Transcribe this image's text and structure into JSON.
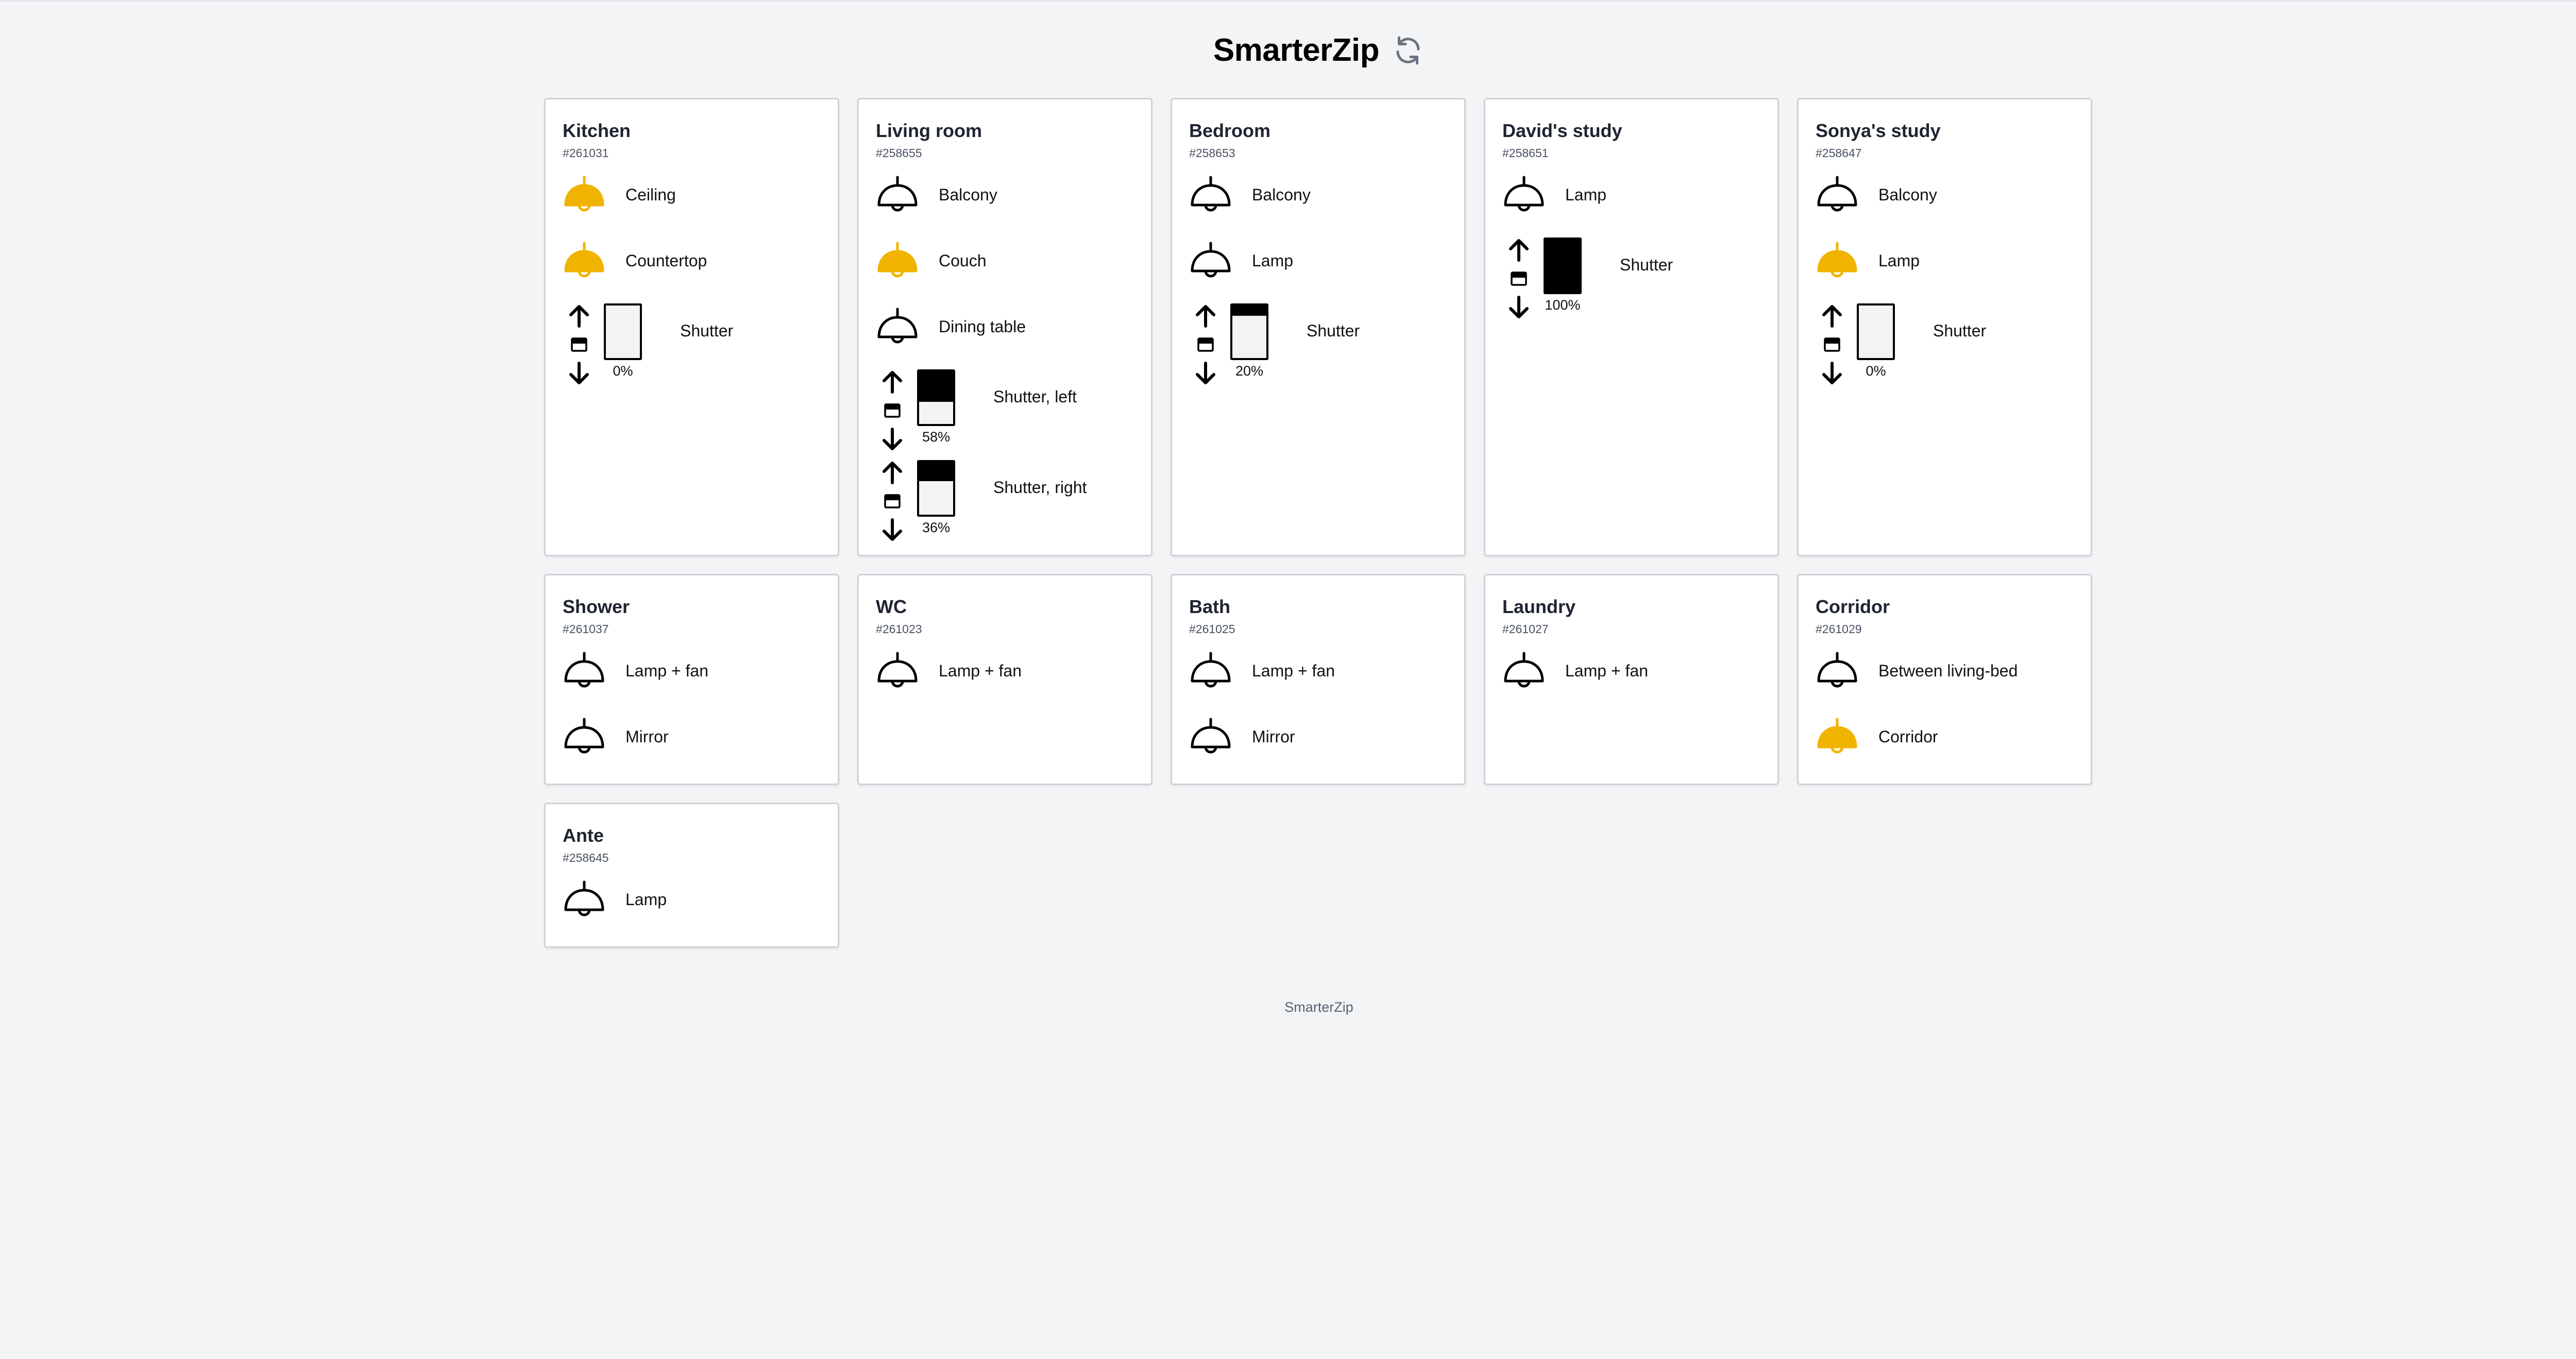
{
  "app": {
    "title": "SmarterZip",
    "footer": "SmarterZip",
    "refresh_icon": "refresh-icon"
  },
  "colors": {
    "lamp_on": "#f0b400",
    "lamp_off": "#ffffff",
    "background": "#f3f4f6"
  },
  "rooms": [
    {
      "name": "Kitchen",
      "id": "#261031",
      "devices": [
        {
          "type": "lamp",
          "label": "Ceiling",
          "on": true
        },
        {
          "type": "lamp",
          "label": "Countertop",
          "on": true
        },
        {
          "type": "shutter",
          "label": "Shutter",
          "percent": 0,
          "percent_text": "0%"
        }
      ]
    },
    {
      "name": "Living room",
      "id": "#258655",
      "devices": [
        {
          "type": "lamp",
          "label": "Balcony",
          "on": false
        },
        {
          "type": "lamp",
          "label": "Couch",
          "on": true
        },
        {
          "type": "lamp",
          "label": "Dining table",
          "on": false
        },
        {
          "type": "shutter",
          "label": "Shutter, left",
          "percent": 58,
          "percent_text": "58%"
        },
        {
          "type": "shutter",
          "label": "Shutter, right",
          "percent": 36,
          "percent_text": "36%"
        }
      ]
    },
    {
      "name": "Bedroom",
      "id": "#258653",
      "devices": [
        {
          "type": "lamp",
          "label": "Balcony",
          "on": false
        },
        {
          "type": "lamp",
          "label": "Lamp",
          "on": false
        },
        {
          "type": "shutter",
          "label": "Shutter",
          "percent": 20,
          "percent_text": "20%"
        }
      ]
    },
    {
      "name": "David's study",
      "id": "#258651",
      "devices": [
        {
          "type": "lamp",
          "label": "Lamp",
          "on": false
        },
        {
          "type": "shutter",
          "label": "Shutter",
          "percent": 100,
          "percent_text": "100%"
        }
      ]
    },
    {
      "name": "Sonya's study",
      "id": "#258647",
      "devices": [
        {
          "type": "lamp",
          "label": "Balcony",
          "on": false
        },
        {
          "type": "lamp",
          "label": "Lamp",
          "on": true
        },
        {
          "type": "shutter",
          "label": "Shutter",
          "percent": 0,
          "percent_text": "0%"
        }
      ]
    },
    {
      "name": "Shower",
      "id": "#261037",
      "devices": [
        {
          "type": "lamp",
          "label": "Lamp + fan",
          "on": false
        },
        {
          "type": "lamp",
          "label": "Mirror",
          "on": false
        }
      ]
    },
    {
      "name": "WC",
      "id": "#261023",
      "devices": [
        {
          "type": "lamp",
          "label": "Lamp + fan",
          "on": false
        }
      ]
    },
    {
      "name": "Bath",
      "id": "#261025",
      "devices": [
        {
          "type": "lamp",
          "label": "Lamp + fan",
          "on": false
        },
        {
          "type": "lamp",
          "label": "Mirror",
          "on": false
        }
      ]
    },
    {
      "name": "Laundry",
      "id": "#261027",
      "devices": [
        {
          "type": "lamp",
          "label": "Lamp + fan",
          "on": false
        }
      ]
    },
    {
      "name": "Corridor",
      "id": "#261029",
      "devices": [
        {
          "type": "lamp",
          "label": "Between living-bed",
          "on": false
        },
        {
          "type": "lamp",
          "label": "Corridor",
          "on": true
        }
      ]
    },
    {
      "name": "Ante",
      "id": "#258645",
      "devices": [
        {
          "type": "lamp",
          "label": "Lamp",
          "on": false
        }
      ]
    }
  ]
}
